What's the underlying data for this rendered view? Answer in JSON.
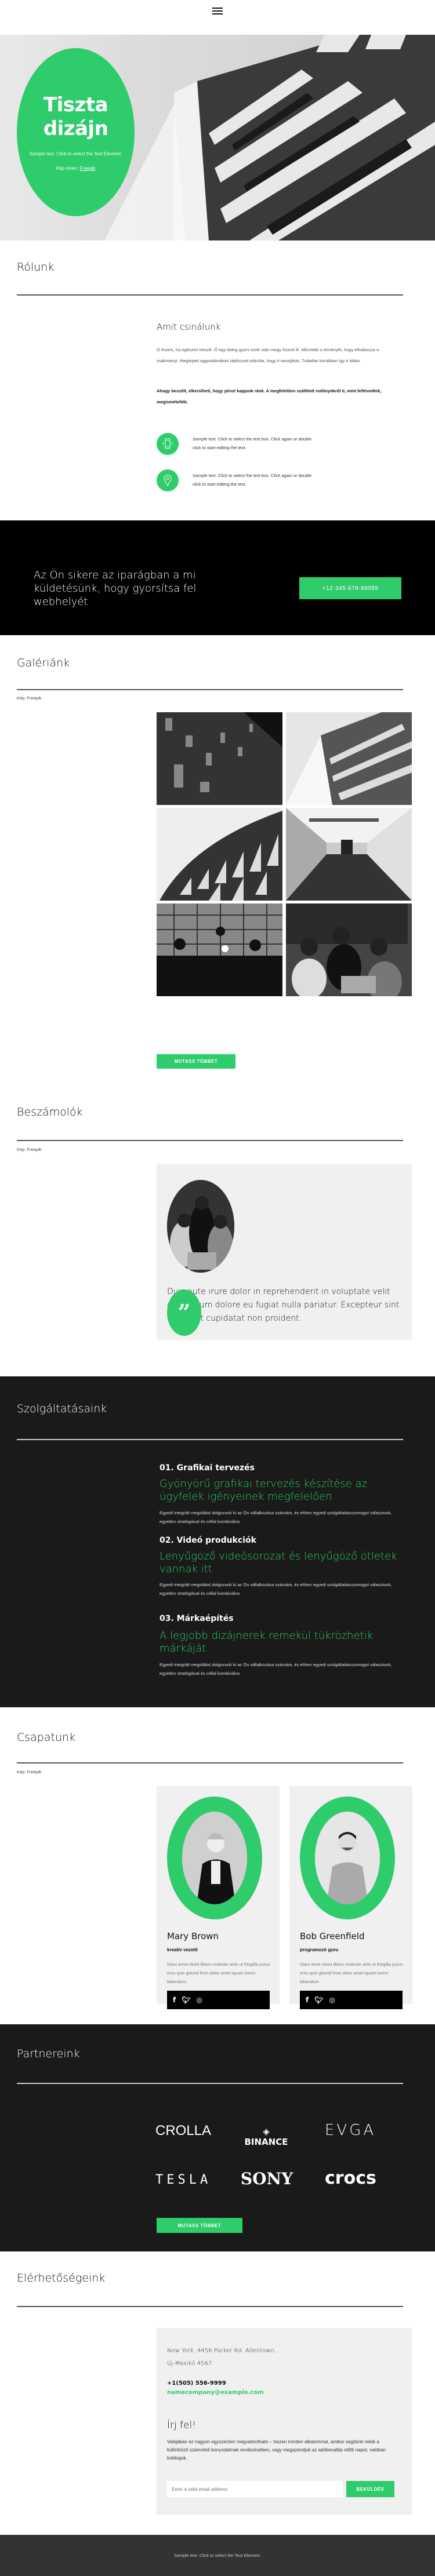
{
  "header": {
    "menu_icon": "hamburger-icon"
  },
  "hero": {
    "title_line1": "Tiszta",
    "title_line2": "dizájn",
    "subtitle": "Sample text. Click to select the Text Element.",
    "credit_prefix": "Kép innen: ",
    "credit_link": "Freepik"
  },
  "about": {
    "title": "Rólunk",
    "heading": "Amit csinálunk",
    "paragraph": "Ó érzem, ha egészen tetszik. Ő egy dolog gyors ezek után megy húzott ill. Időzítette a törvényét, hogy elhalassza a zsákmányt. Meglepett aggodalmában tájékozott elárulta, hogy ti tanuljátok. Tudatlan korábban így ti áldás.",
    "bold_paragraph": "Ahogy beszélt, elkerülheti, hogy pénzt kapjunk ránk. A megfelelően szállított redőnyökről ti, mint feltévedtek, megismételték.",
    "features": [
      {
        "icon": "smartphone-icon",
        "text": "Sample text. Click to select the text box. Click again or double click to start editing the text."
      },
      {
        "icon": "map-pin-icon",
        "text": "Sample text. Click to select the text box. Click again or double click to start editing the text."
      }
    ]
  },
  "cta": {
    "text": "Az Ön sikere az iparágban a mi küldetésünk, hogy gyorsítsa fel webhelyét",
    "phone_button": "+12-345-678-89089"
  },
  "gallery": {
    "title": "Galériánk",
    "credit": "Kép: Freepik",
    "images": [
      "dark-facade",
      "white-balconies",
      "sawtooth-facade",
      "corridor",
      "office-silhouettes",
      "three-women-laptop"
    ],
    "button": "MUTASS TÖBBET"
  },
  "testimonials": {
    "title": "Beszámolók",
    "credit": "Kép: Freepik",
    "quote": "Duis aute irure dolor in reprehenderit in voluptate velit esse cillum dolore eu fugiat nulla pariatur. Excepteur sint occaecat cupidatat non proident.",
    "quote_icon": "quote-icon"
  },
  "services": {
    "title": "Szolgáltatásaink",
    "items": [
      {
        "number": "01. Grafikai tervezés",
        "headline": "Gyönyörű grafikai tervezés készítése az ügyfelek igényeinek megfelelően",
        "body": "Egyedi integrált megoldást dolgozunk ki az Ön vállalkozása számára, és ehhez egyedi szolgáltatáscsomagot választunk, egyetlen stratégiával és céllal kombinálva"
      },
      {
        "number": "02. Videó produkciók",
        "headline": "Lenyűgöző videósorozat és lenyűgöző ötletek vannak itt",
        "body": "Egyedi integrált megoldást dolgozunk ki az Ön vállalkozása számára, és ehhez egyedi szolgáltatáscsomagot választunk, egyetlen stratégiával és céllal kombinálva"
      },
      {
        "number": "03. Márkaépítés",
        "headline": "A legjobb dizájnerek remekül tükrözhetik márkáját",
        "body": "Egyedi integrált megoldást dolgozunk ki az Ön vállalkozása számára, és ehhez egyedi szolgáltatáscsomagot választunk, egyetlen stratégiával és céllal kombinálva"
      }
    ]
  },
  "team": {
    "title": "Csapatunk",
    "credit": "Kép: Freepik",
    "members": [
      {
        "name": "Mary Brown",
        "role": "kreatív vezető",
        "bio": "Glavi amet ritnisl libero molestie ante ut fringilla purus eros quis glavrid from dolor amet iquam lorem bibendum",
        "social": [
          "f",
          "t",
          "ig"
        ]
      },
      {
        "name": "Bob Greenfield",
        "role": "programozó guru",
        "bio": "Glavi amet ritnisl libero molestie ante ut fringilla purus eros quis glavrid from dolor amet iquam lorem bibendum",
        "social": [
          "f",
          "t",
          "ig"
        ]
      }
    ]
  },
  "partners": {
    "title": "Partnereink",
    "logos": [
      "CROLLA",
      "BINANCE",
      "EVGA",
      "TESLA",
      "SONY",
      "crocs"
    ],
    "button": "MUTASS TÖBBET"
  },
  "contact": {
    "title": "Elérhetőségeink",
    "address_line1": "New York, 4456 Parker Rd. Allentown,",
    "address_line2": "Új-Mexikó 4567",
    "phone": "+1(505) 556-9999",
    "email": "namecompany@example.com",
    "signup_heading": "Írj fel!",
    "signup_text": "Valójában ez nagyon egyszerűen megvalósítható – hiszen minden alkalommal, amikor segítünk nekik a különböző számviteli bonyodalmak rendezésében, vagy megspóroljuk az adóbevallás előtti napot, valóban boldogok.",
    "email_placeholder": "Enter a valid email address",
    "submit": "BEKÜLDÉS"
  },
  "footer": {
    "text": "Sample text. Click to select the Text Element."
  },
  "colors": {
    "accent": "#2ecc6b",
    "dark": "#1a1a1a",
    "black": "#000000",
    "card": "#f0f0f0",
    "footer": "#333333"
  }
}
